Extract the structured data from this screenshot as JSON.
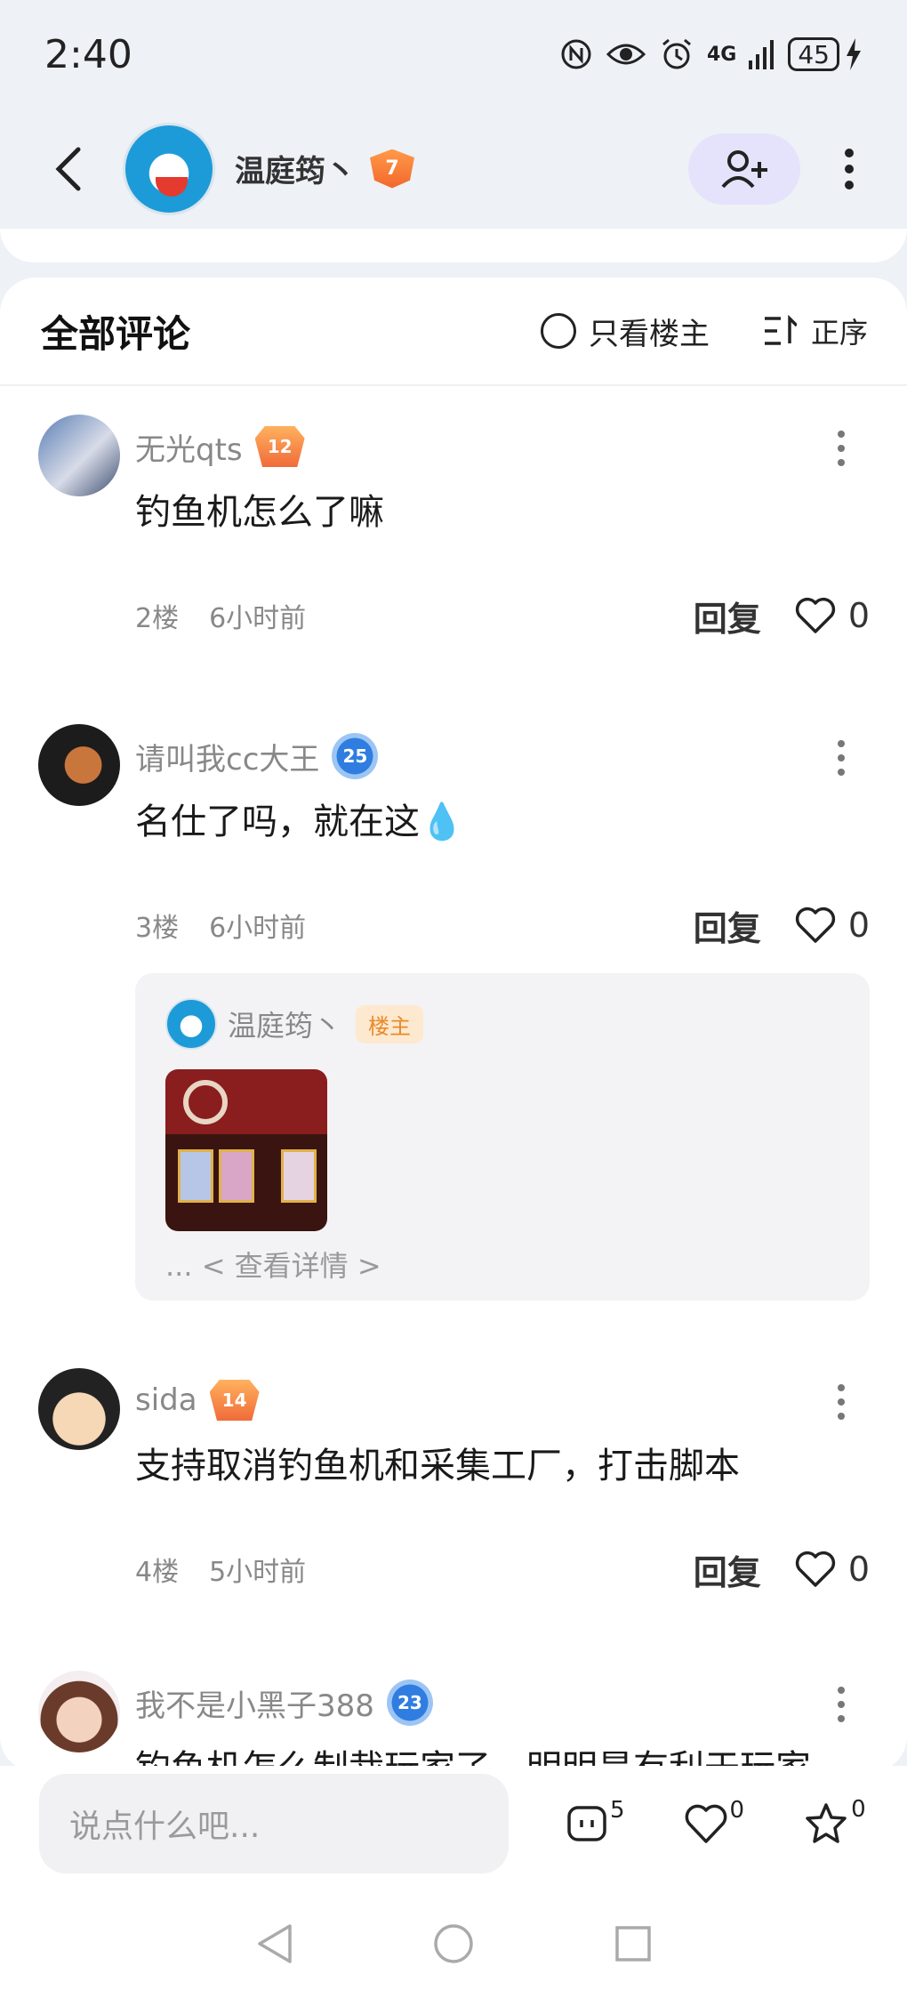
{
  "status_bar": {
    "time": "2:40",
    "network": "4G",
    "battery": "45"
  },
  "header": {
    "username": "温庭筠丶",
    "level": "7"
  },
  "comments_panel": {
    "title": "全部评论",
    "only_op_label": "只看楼主",
    "sort_label": "正序"
  },
  "comments": [
    {
      "name": "无光qts",
      "level": "12",
      "text": "钓鱼机怎么了嘛",
      "floor": "2楼",
      "time": "6小时前",
      "reply": "回复",
      "likes": "0"
    },
    {
      "name": "请叫我cc大王",
      "level": "25",
      "text": "名仕了吗，就在这💧",
      "floor": "3楼",
      "time": "6小时前",
      "reply": "回复",
      "likes": "0",
      "quote": {
        "name": "温庭筠丶",
        "tag": "楼主",
        "more": "... < 查看详情 >"
      }
    },
    {
      "name": "sida",
      "level": "14",
      "text": "支持取消钓鱼机和采集工厂，打击脚本",
      "floor": "4楼",
      "time": "5小时前",
      "reply": "回复",
      "likes": "0"
    },
    {
      "name": "我不是小黑子388",
      "level": "23",
      "text": "钓鱼机怎么制裁玩家了，明明是有利于玩家"
    }
  ],
  "bottom_bar": {
    "input_placeholder": "说点什么吧...",
    "comment_count": "5",
    "like_count": "0",
    "fav_count": "0"
  }
}
